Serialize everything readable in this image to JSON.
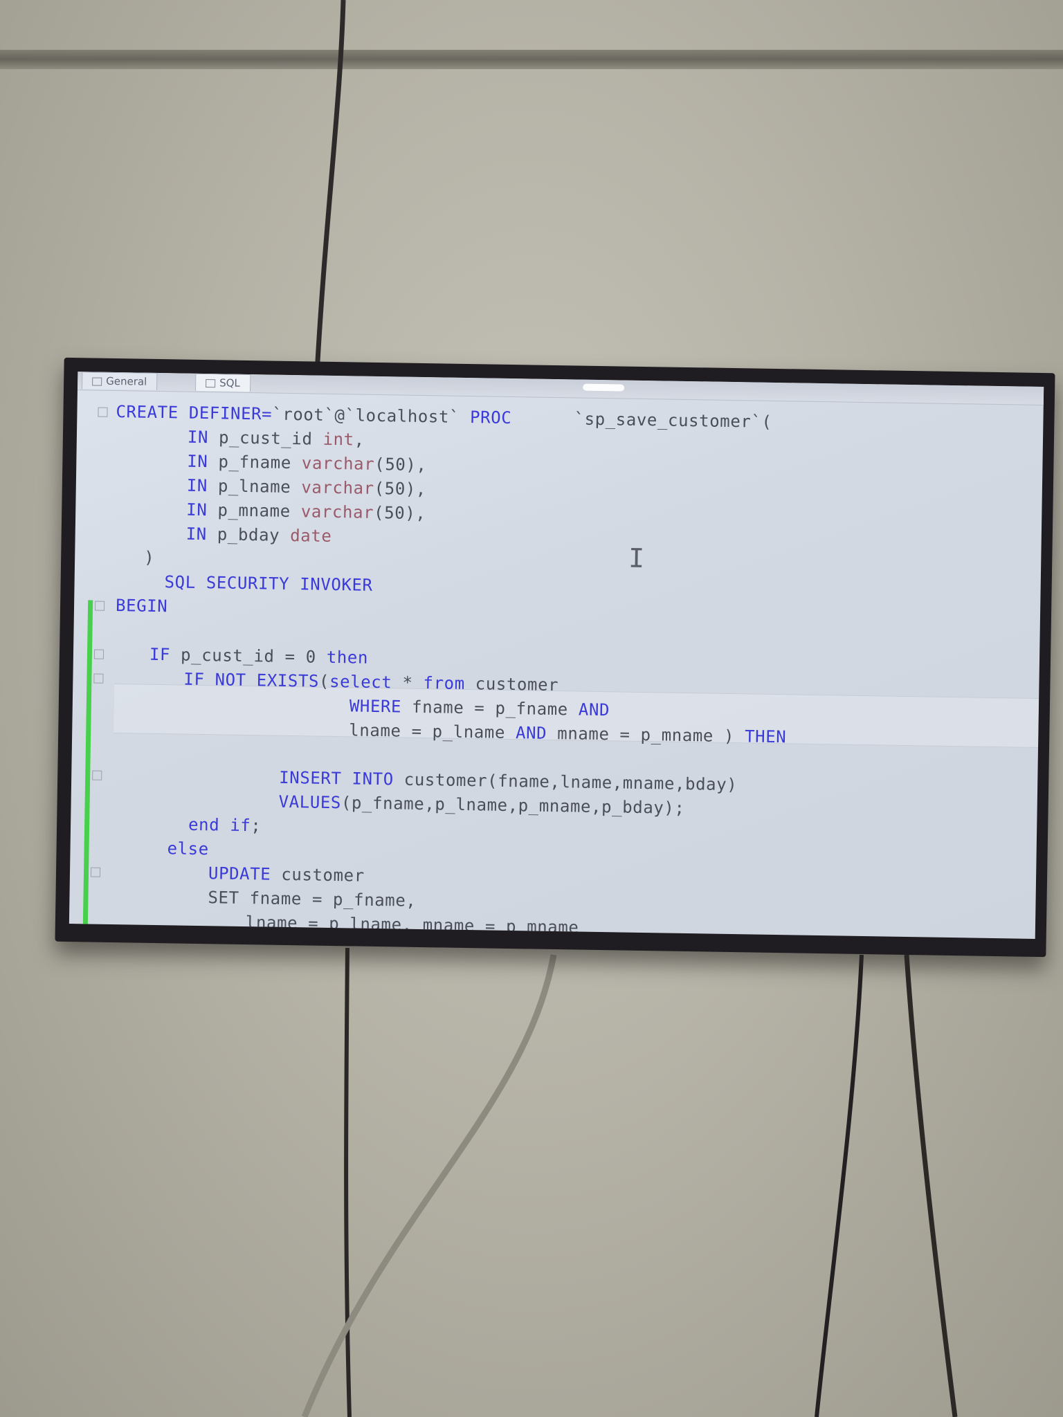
{
  "tabs": [
    {
      "label": "General"
    },
    {
      "label": "SQL"
    }
  ],
  "code_lines": [
    {
      "tokens": [
        {
          "t": "CREATE DEFINER=",
          "c": "kw"
        },
        {
          "t": "`root`@`localhost` ",
          "c": ""
        },
        {
          "t": "PROC",
          "c": "kw"
        },
        {
          "t": "      ",
          "c": ""
        },
        {
          "t": "`sp_save_customer`(",
          "c": ""
        }
      ]
    },
    {
      "tokens": [
        {
          "t": "IN",
          "c": "kw"
        },
        {
          "t": " p_cust_id ",
          "c": ""
        },
        {
          "t": "int",
          "c": "ty"
        },
        {
          "t": ",",
          "c": ""
        }
      ]
    },
    {
      "tokens": [
        {
          "t": "IN",
          "c": "kw"
        },
        {
          "t": " p_fname ",
          "c": ""
        },
        {
          "t": "varchar",
          "c": "ty"
        },
        {
          "t": "(50),",
          "c": ""
        }
      ]
    },
    {
      "tokens": [
        {
          "t": "IN",
          "c": "kw"
        },
        {
          "t": " p_lname ",
          "c": ""
        },
        {
          "t": "varchar",
          "c": "ty"
        },
        {
          "t": "(50),",
          "c": ""
        }
      ]
    },
    {
      "tokens": [
        {
          "t": "IN",
          "c": "kw"
        },
        {
          "t": " p_mname ",
          "c": ""
        },
        {
          "t": "varchar",
          "c": "ty"
        },
        {
          "t": "(50),",
          "c": ""
        }
      ]
    },
    {
      "tokens": [
        {
          "t": "IN",
          "c": "kw"
        },
        {
          "t": " p_bday ",
          "c": ""
        },
        {
          "t": "date",
          "c": "ty"
        }
      ]
    },
    {
      "tokens": [
        {
          "t": ")",
          "c": ""
        }
      ]
    },
    {
      "tokens": [
        {
          "t": "SQL SECURITY INVOKER",
          "c": "kw"
        }
      ]
    },
    {
      "tokens": [
        {
          "t": "BEGIN",
          "c": "kw"
        }
      ]
    },
    {
      "tokens": []
    },
    {
      "tokens": [
        {
          "t": "IF",
          "c": "kw"
        },
        {
          "t": " p_cust_id = 0 ",
          "c": ""
        },
        {
          "t": "then",
          "c": "kw"
        }
      ]
    },
    {
      "tokens": [
        {
          "t": "IF NOT EXISTS",
          "c": "kw"
        },
        {
          "t": "(",
          "c": ""
        },
        {
          "t": "select",
          "c": "kw"
        },
        {
          "t": " * ",
          "c": ""
        },
        {
          "t": "from",
          "c": "kw"
        },
        {
          "t": " customer",
          "c": ""
        }
      ]
    },
    {
      "tokens": [
        {
          "t": "WHERE",
          "c": "kw"
        },
        {
          "t": " fname = p_fname ",
          "c": ""
        },
        {
          "t": "AND",
          "c": "kw"
        }
      ]
    },
    {
      "tokens": [
        {
          "t": "lname = p_lname ",
          "c": ""
        },
        {
          "t": "AND",
          "c": "kw"
        },
        {
          "t": " mname = p_mname ) ",
          "c": ""
        },
        {
          "t": "THEN",
          "c": "kw"
        }
      ]
    },
    {
      "tokens": []
    },
    {
      "tokens": [
        {
          "t": "INSERT INTO",
          "c": "kw"
        },
        {
          "t": " customer(fname,lname,mname,bday)",
          "c": ""
        }
      ]
    },
    {
      "tokens": [
        {
          "t": "VALUES",
          "c": "kw"
        },
        {
          "t": "(p_fname,p_lname,p_mname,p_bday);",
          "c": ""
        }
      ]
    },
    {
      "tokens": [
        {
          "t": "end if",
          "c": "kw"
        },
        {
          "t": ";",
          "c": ""
        }
      ]
    },
    {
      "tokens": [
        {
          "t": "else",
          "c": "kw"
        }
      ]
    },
    {
      "tokens": [
        {
          "t": "UPDATE",
          "c": "kw"
        },
        {
          "t": " customer",
          "c": ""
        }
      ]
    },
    {
      "tokens": [
        {
          "t": "SET",
          "c": ""
        },
        {
          "t": " fname = p_fname,",
          "c": ""
        }
      ]
    },
    {
      "tokens": [
        {
          "t": "lname = p_lname, mname = p_mname",
          "c": ""
        }
      ]
    }
  ]
}
